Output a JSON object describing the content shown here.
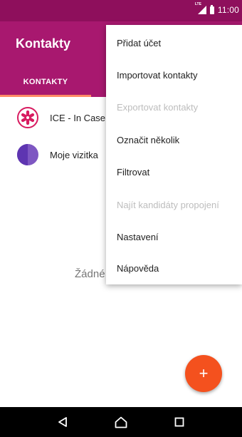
{
  "status_bar": {
    "network_label": "LTE",
    "time": "11:00"
  },
  "app_bar": {
    "title": "Kontakty",
    "tab_label": "KONTAKTY"
  },
  "contacts": [
    {
      "name": "ICE - In Case of Emergency",
      "avatar": "ice-asterisk-icon"
    },
    {
      "name": "Moje vizitka",
      "avatar": "profile-card-icon"
    }
  ],
  "empty_text": "Žádné kontakty",
  "menu": {
    "items": [
      {
        "label": "Přidat účet",
        "enabled": true
      },
      {
        "label": "Importovat kontakty",
        "enabled": true
      },
      {
        "label": "Exportovat kontakty",
        "enabled": false
      },
      {
        "label": "Označit několik",
        "enabled": true
      },
      {
        "label": "Filtrovat",
        "enabled": true
      },
      {
        "label": "Najít kandidáty propojení",
        "enabled": false
      },
      {
        "label": "Nastavení",
        "enabled": true
      },
      {
        "label": "Nápověda",
        "enabled": true
      }
    ]
  },
  "fab": {
    "icon": "plus-icon",
    "label": "+"
  },
  "nav_bar": {
    "icons": [
      "back-icon",
      "home-icon",
      "recents-icon"
    ]
  },
  "colors": {
    "status_bar": "#8e0f5c",
    "app_bar": "#a8186f",
    "tab_indicator": "#ff8a65",
    "fab": "#f4511e",
    "disabled_text": "#bdbdbd"
  }
}
